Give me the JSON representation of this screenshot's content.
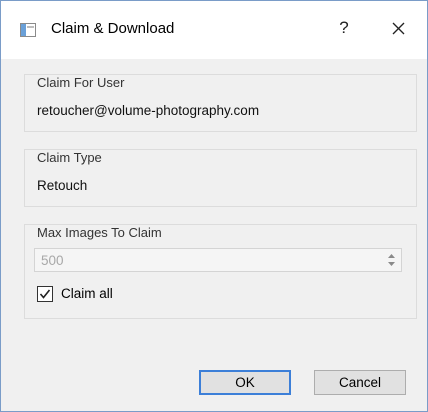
{
  "window": {
    "title": "Claim & Download",
    "help_label": "?"
  },
  "claim_for_user": {
    "title": "Claim For User",
    "value": "retoucher@volume-photography.com"
  },
  "claim_type": {
    "title": "Claim Type",
    "value": "Retouch"
  },
  "max_images": {
    "title": "Max Images To Claim",
    "value": "500",
    "enabled": false
  },
  "claim_all": {
    "label": "Claim all",
    "checked": true
  },
  "buttons": {
    "ok": "OK",
    "cancel": "Cancel"
  },
  "icons": {
    "app": "window-icon",
    "close": "close-icon",
    "spin": "spin-arrows-icon",
    "check": "checkmark-icon"
  },
  "colors": {
    "accent": "#3c7fd8",
    "window_border": "#7a9cc8"
  }
}
